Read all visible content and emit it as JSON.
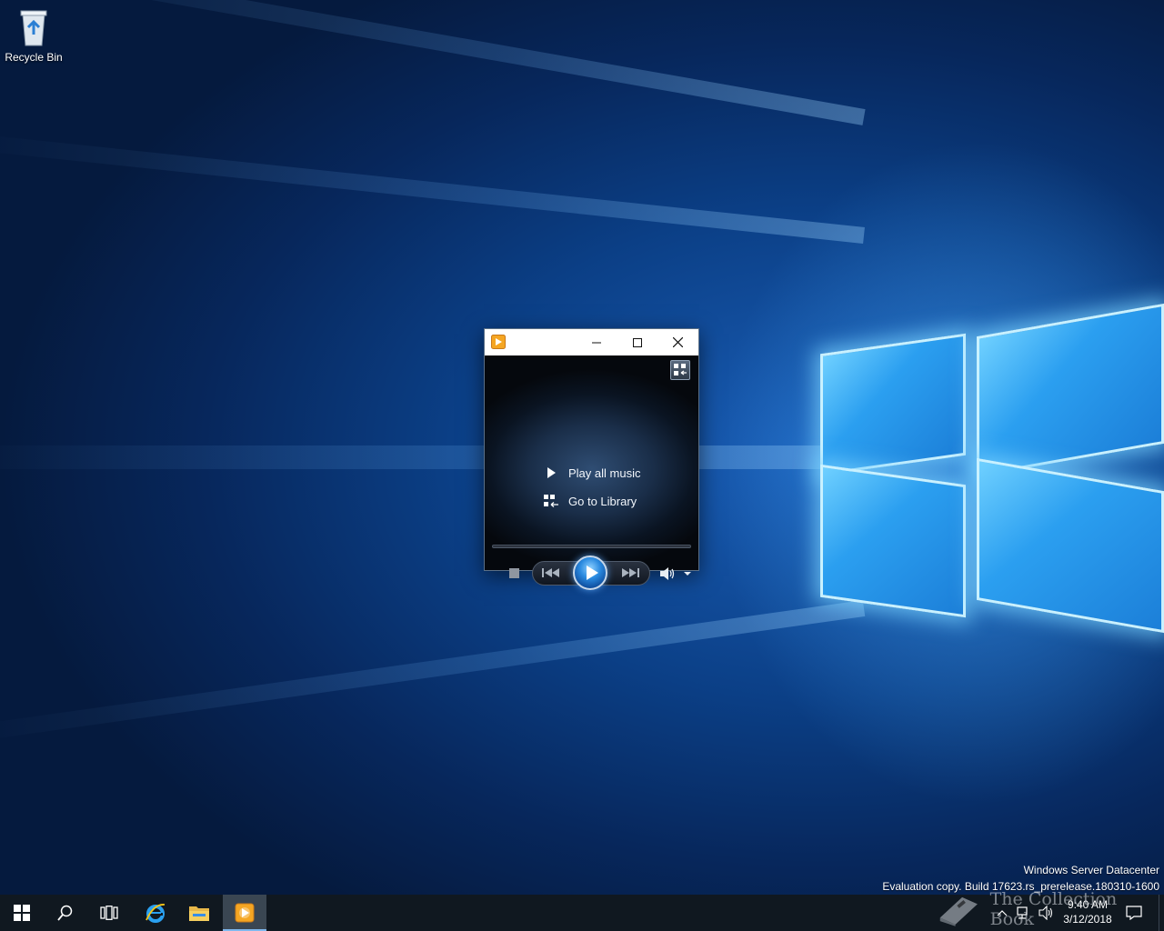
{
  "desktop": {
    "icons": [
      {
        "label": "Recycle Bin",
        "icon": "recycle-bin-icon"
      }
    ],
    "watermark": {
      "edition": "Windows Server Datacenter",
      "build": "Evaluation copy. Build 17623.rs_prerelease.180310-1600"
    },
    "overlay_logo_text": "The Collection Book"
  },
  "media_player": {
    "title_icon": "windows-media-player-icon",
    "caption_buttons": [
      "minimize",
      "maximize",
      "close"
    ],
    "links": [
      {
        "label": "Play all music",
        "icon": "play-triangle-icon"
      },
      {
        "label": "Go to Library",
        "icon": "library-icon"
      }
    ],
    "controls": [
      "stop",
      "previous",
      "play",
      "next",
      "volume",
      "volume-dropdown"
    ],
    "accent_color": "#2a8ae0"
  },
  "taskbar": {
    "pinned": [
      {
        "name": "Start",
        "icon": "windows-logo-icon"
      },
      {
        "name": "Search",
        "icon": "search-icon"
      },
      {
        "name": "Task View",
        "icon": "task-view-icon"
      },
      {
        "name": "Internet Explorer",
        "icon": "internet-explorer-icon"
      },
      {
        "name": "File Explorer",
        "icon": "folder-icon"
      },
      {
        "name": "Windows Media Player",
        "icon": "windows-media-player-icon",
        "active": true
      }
    ],
    "clock": {
      "time": "9:40 AM",
      "date": "3/12/2018"
    },
    "background": "#101820"
  }
}
